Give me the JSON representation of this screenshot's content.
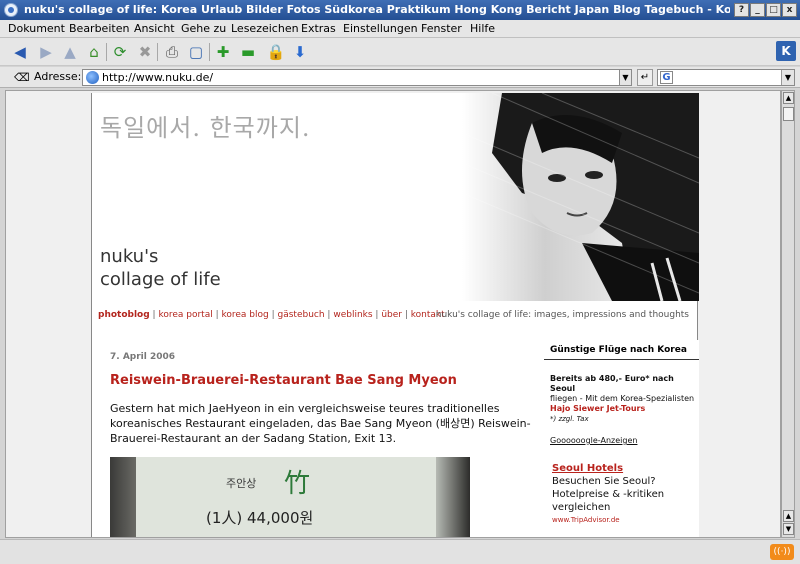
{
  "window": {
    "title": "nuku's collage of life: Korea Urlaub Bilder Fotos Südkorea Praktikum Hong Kong Bericht Japan Blog Tagebuch - Konqueror",
    "help_btn": "?",
    "min_btn": "_",
    "max_btn": "□",
    "close_btn": "x"
  },
  "menubar": {
    "items": [
      "Dokument",
      "Bearbeiten",
      "Ansicht",
      "Gehe zu",
      "Lesezeichen",
      "Extras",
      "Einstellungen",
      "Fenster",
      "Hilfe"
    ]
  },
  "locationbar": {
    "label": "Adresse:",
    "url": "http://www.nuku.de/"
  },
  "page": {
    "korean_title": "독일에서. 한국까지.",
    "blog_name_line1": "nuku's",
    "blog_name_line2": "collage of life",
    "nav": [
      "photoblog",
      "korea portal",
      "korea blog",
      "gästebuch",
      "weblinks",
      "über",
      "kontakt"
    ],
    "tagline": "nuku's collage of life: images, impressions and thoughts",
    "post": {
      "date": "7. April 2006",
      "title": "Reiswein-Brauerei-Restaurant Bae Sang Myeon",
      "text": "Gestern hat mich JaeHyeon in ein vergleichsweise teures traditionelles koreanisches Restaurant eingeladen, das Bae Sang Myeon (배상면) Reiswein-Brauerei-Restaurant an der Sadang Station, Exit 13.",
      "photo_text1": "주안상",
      "photo_text2": "竹",
      "photo_text3": "(1人) 44,000원"
    },
    "sidebar": {
      "heading": "Günstige Flüge nach Korea",
      "ad1_line1": "Bereits ab 480,- Euro* nach Seoul",
      "ad1_line2": "fliegen - Mit dem Korea-Spezialisten",
      "ad1_link": "Hajo Siewer Jet-Tours",
      "ad1_note": "*) zzgl. Tax",
      "google_ads": "Goooooogle-Anzeigen",
      "ad2_title": "Seoul Hotels",
      "ad2_text": "Besuchen Sie Seoul? Hotelpreise & -kritiken vergleichen",
      "ad2_url": "www.TripAdvisor.de"
    }
  }
}
